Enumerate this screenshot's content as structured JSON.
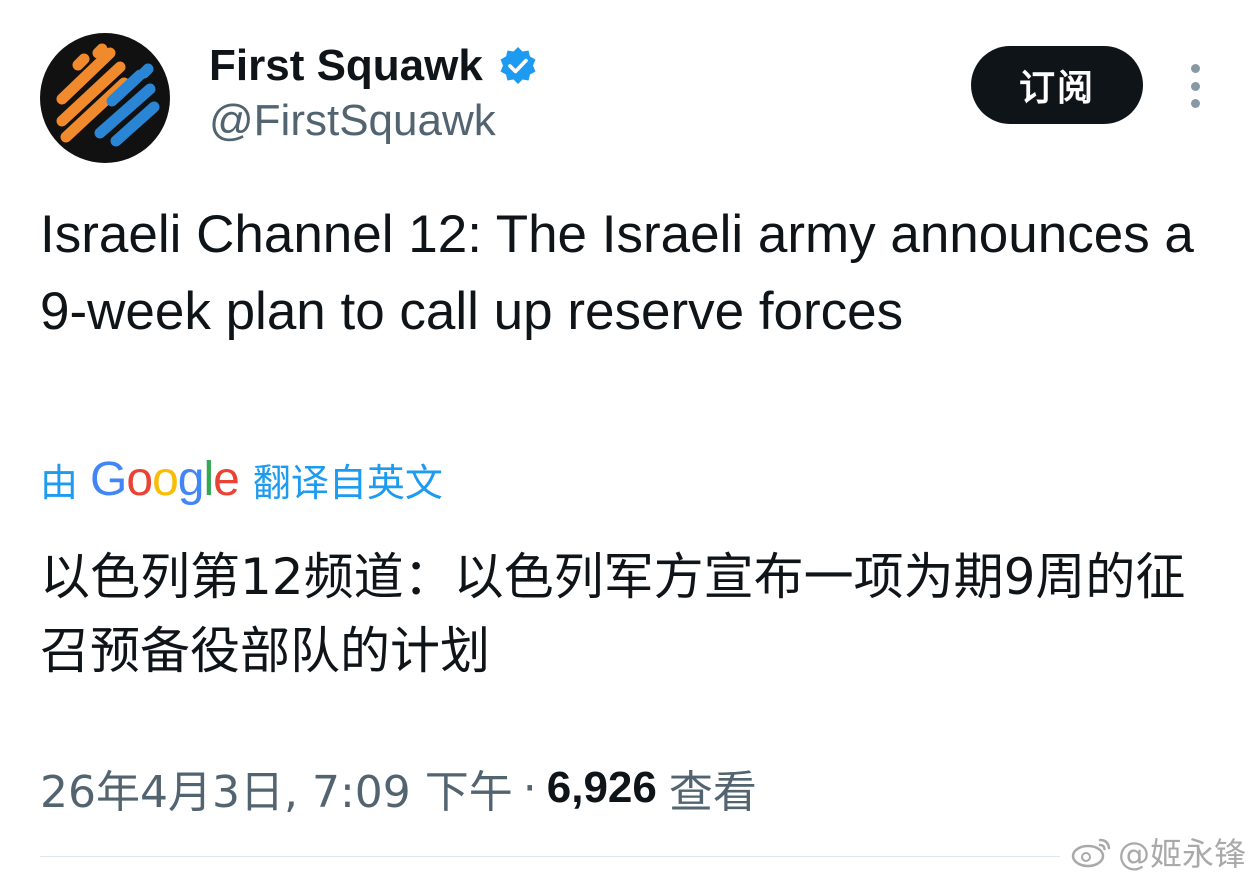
{
  "account": {
    "display_name": "First Squawk",
    "handle": "@FirstSquawk",
    "verified": true,
    "subscribe_label": "订阅"
  },
  "tweet": {
    "text": "Israeli Channel 12: The Israeli army announces a 9-week plan to call up reserve forces",
    "translation_prefix": "由",
    "translation_provider": "Google",
    "translation_suffix": "翻译自英文",
    "translated_text": "以色列第12频道：以色列军方宣布一项为期9周的征召预备役部队的计划",
    "timestamp": "26年4月3日, 7:09 下午",
    "separator": "·",
    "views_count": "6,926",
    "views_label": "查看"
  },
  "watermark": {
    "text": "@姬永锋"
  },
  "colors": {
    "accent": "#1d9bf0",
    "text_primary": "#0f1419",
    "text_secondary": "#536471",
    "button_bg": "#0f1419",
    "avatar_orange": "#f08a2c",
    "avatar_blue": "#2a86d4"
  },
  "icons": {
    "verified": "verified-badge-icon",
    "more": "more-options-icon",
    "watermark": "weibo-logo-icon"
  }
}
